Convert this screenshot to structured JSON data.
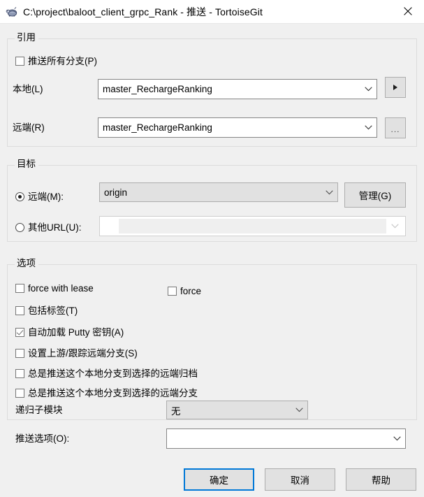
{
  "window": {
    "title": "C:\\project\\baloot_client_grpc_Rank - 推送 - TortoiseGit",
    "icon": "tortoisegit-turtle-icon",
    "close_label": "✕",
    "accent_color": "#0078d7",
    "background_color": "#f0f0f0"
  },
  "reference_group": {
    "title": "引用",
    "push_all_branches": {
      "label": "推送所有分支(P)",
      "checked": false
    },
    "local": {
      "label": "本地(L)",
      "value": "master_RechargeRanking",
      "button_label": "▶"
    },
    "remote": {
      "label": "远端(R)",
      "value": "master_RechargeRanking",
      "button_label": "..."
    }
  },
  "destination_group": {
    "title": "目标",
    "remote_radio": {
      "label": "远端(M):",
      "selected": true
    },
    "remote_value": "origin",
    "manage_button": "管理(G)",
    "url_radio": {
      "label": "其他URL(U):",
      "selected": false
    },
    "url_value": ""
  },
  "options_group": {
    "title": "选项",
    "checkboxes": [
      {
        "label": "force with lease",
        "checked": false
      },
      {
        "label": "force",
        "checked": false
      },
      {
        "label": "包括标签(T)",
        "checked": false
      },
      {
        "label": "自动加载 Putty 密钥(A)",
        "checked": true
      },
      {
        "label": "设置上游/跟踪远端分支(S)",
        "checked": false
      },
      {
        "label": "总是推送这个本地分支到选择的远端归档",
        "checked": false
      },
      {
        "label": "总是推送这个本地分支到选择的远端分支",
        "checked": false
      }
    ],
    "recursive_submodule": {
      "label": "递归子模块",
      "value": "无"
    }
  },
  "push_options": {
    "label": "推送选项(O):",
    "value": ""
  },
  "buttons": {
    "ok": "确定",
    "cancel": "取消",
    "help": "帮助"
  }
}
